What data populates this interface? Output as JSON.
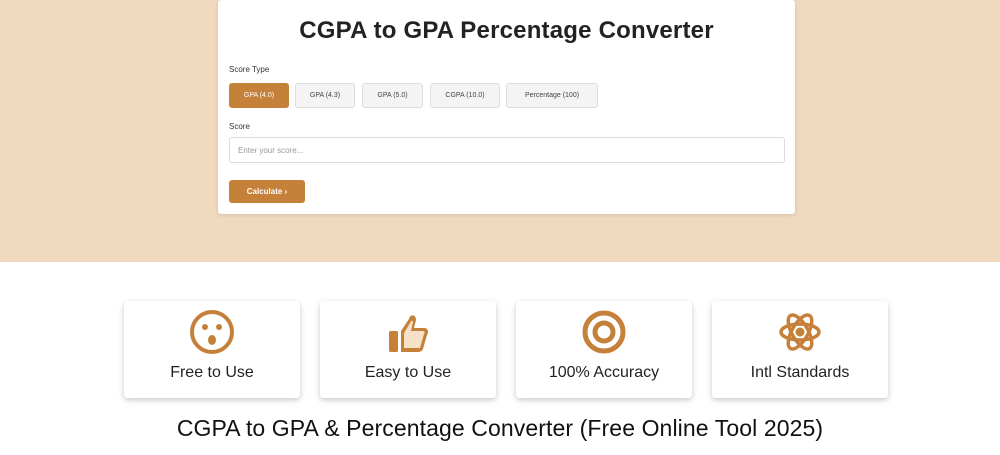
{
  "converter": {
    "title": "CGPA to GPA Percentage Converter",
    "score_type_label": "Score Type",
    "score_types": [
      "GPA (4.0)",
      "GPA (4.3)",
      "GPA (5.0)",
      "CGPA (10.0)",
      "Percentage (100)"
    ],
    "selected_score_type": "GPA (4.0)",
    "score_label": "Score",
    "score_placeholder": "Enter your score...",
    "score_value": "",
    "calculate_label": "Calculate ›"
  },
  "features": [
    {
      "label": "Free to Use",
      "icon": "surprised-face-icon"
    },
    {
      "label": "Easy to Use",
      "icon": "thumbs-up-icon"
    },
    {
      "label": "100% Accuracy",
      "icon": "target-icon"
    },
    {
      "label": "Intl Standards",
      "icon": "atom-icon"
    }
  ],
  "page_heading": "CGPA to GPA & Percentage Converter (Free Online Tool 2025)",
  "colors": {
    "accent": "#c5803a",
    "hero_background": "#f0d9bf",
    "page_background": "#ffffff"
  }
}
